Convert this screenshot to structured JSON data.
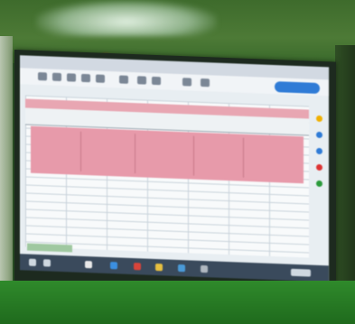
{
  "scene": {
    "type": "photo-of-projected-spreadsheet-screen",
    "share_button_label": "",
    "colors": {
      "header_band": "#e8a6b2",
      "row_highlight": "#e79aaa",
      "share_button": "#2f7bd6",
      "taskbar": "#3a4a5c",
      "wall": "#4d7a36",
      "floor": "#1f6a1d"
    }
  }
}
